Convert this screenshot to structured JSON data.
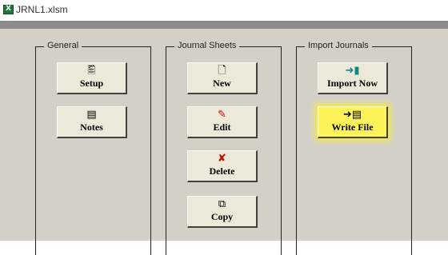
{
  "window": {
    "title": "JRNL1.xlsm",
    "file_icon": "excel-file-icon"
  },
  "groups": {
    "general": {
      "title": "General",
      "buttons": {
        "setup": {
          "label": "Setup",
          "icon": "setup-icon"
        },
        "notes": {
          "label": "Notes",
          "icon": "notes-icon"
        }
      }
    },
    "journal_sheets": {
      "title": "Journal Sheets",
      "buttons": {
        "new": {
          "label": "New",
          "icon": "new-page-icon"
        },
        "edit": {
          "label": "Edit",
          "icon": "pencil-icon"
        },
        "delete": {
          "label": "Delete",
          "icon": "delete-icon"
        },
        "copy": {
          "label": "Copy",
          "icon": "copy-icon"
        }
      }
    },
    "import_journals": {
      "title": "Import Journals",
      "buttons": {
        "import_now": {
          "label": "Import Now",
          "icon": "import-database-icon"
        },
        "write_file": {
          "label": "Write File",
          "icon": "write-file-icon",
          "highlighted": true
        }
      }
    }
  },
  "colors": {
    "form_background": "#d4d0c8",
    "button_face": "#ece9d8",
    "highlight": "#fff35a",
    "excel_green": "#1f7a3a",
    "delete_red": "#cc0000"
  }
}
